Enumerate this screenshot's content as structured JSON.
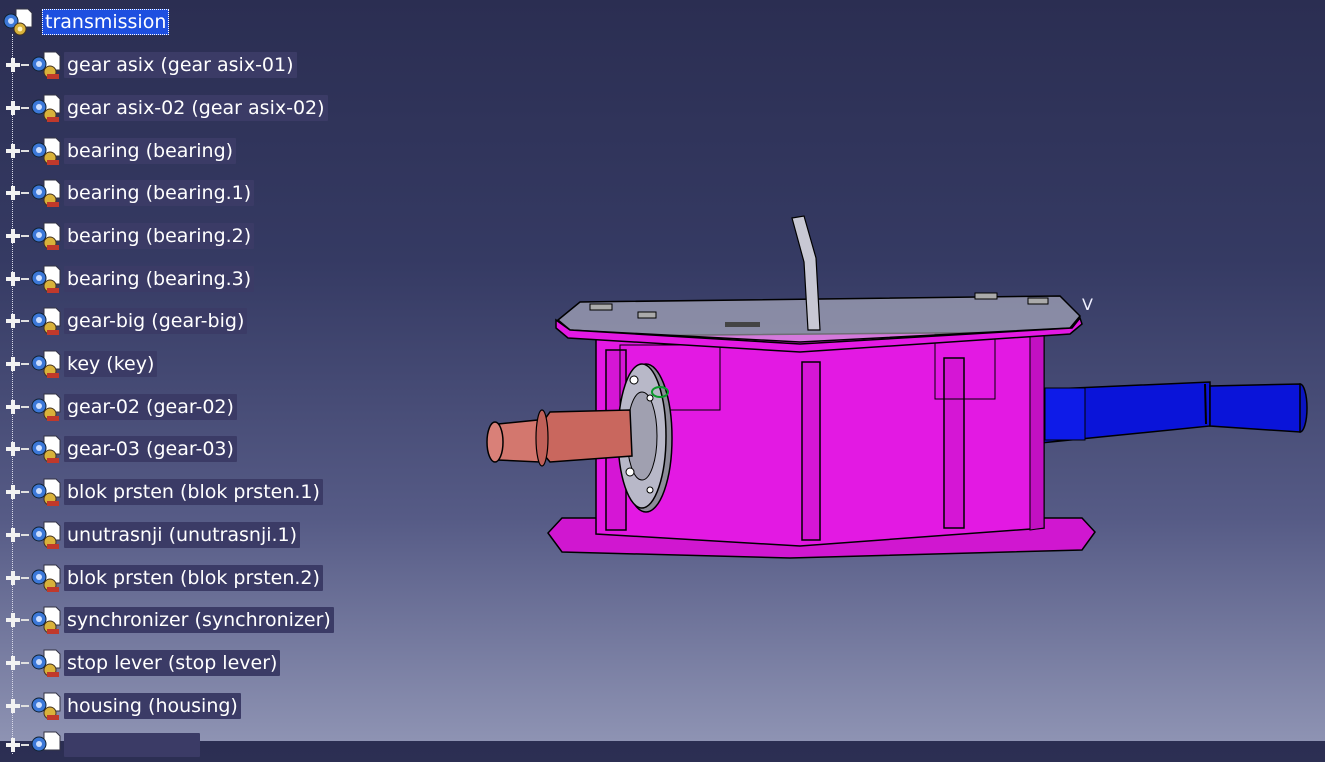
{
  "tree": {
    "root": {
      "label": "transmission",
      "icon": "product-icon"
    },
    "nodes": [
      {
        "label": "gear  asix (gear asix-01)"
      },
      {
        "label": "gear asix-02 (gear asix-02)"
      },
      {
        "label": "bearing (bearing)"
      },
      {
        "label": "bearing (bearing.1)"
      },
      {
        "label": "bearing (bearing.2)"
      },
      {
        "label": "bearing (bearing.3)"
      },
      {
        "label": "gear-big (gear-big)"
      },
      {
        "label": "key (key)"
      },
      {
        "label": "gear-02 (gear-02)"
      },
      {
        "label": "gear-03 (gear-03)"
      },
      {
        "label": "blok prsten (blok prsten.1)"
      },
      {
        "label": "unutrasnji (unutrasnji.1)"
      },
      {
        "label": "blok prsten (blok prsten.2)"
      },
      {
        "label": "synchronizer (synchronizer)"
      },
      {
        "label": "stop lever (stop lever)"
      },
      {
        "label": "housing (housing)"
      },
      {
        "label": ""
      }
    ],
    "node_icon": "part-gear-icon",
    "expander_icon": "plus-expand-icon"
  },
  "viewport": {
    "model_name": "transmission-3d-model",
    "axis_label": "V",
    "colors": {
      "housing": "#e319e3",
      "input_shaft": "#c9675e",
      "output_shaft": "#0a14d9",
      "lever": "#c8c8d4",
      "flange": "#b8b8c8"
    }
  }
}
